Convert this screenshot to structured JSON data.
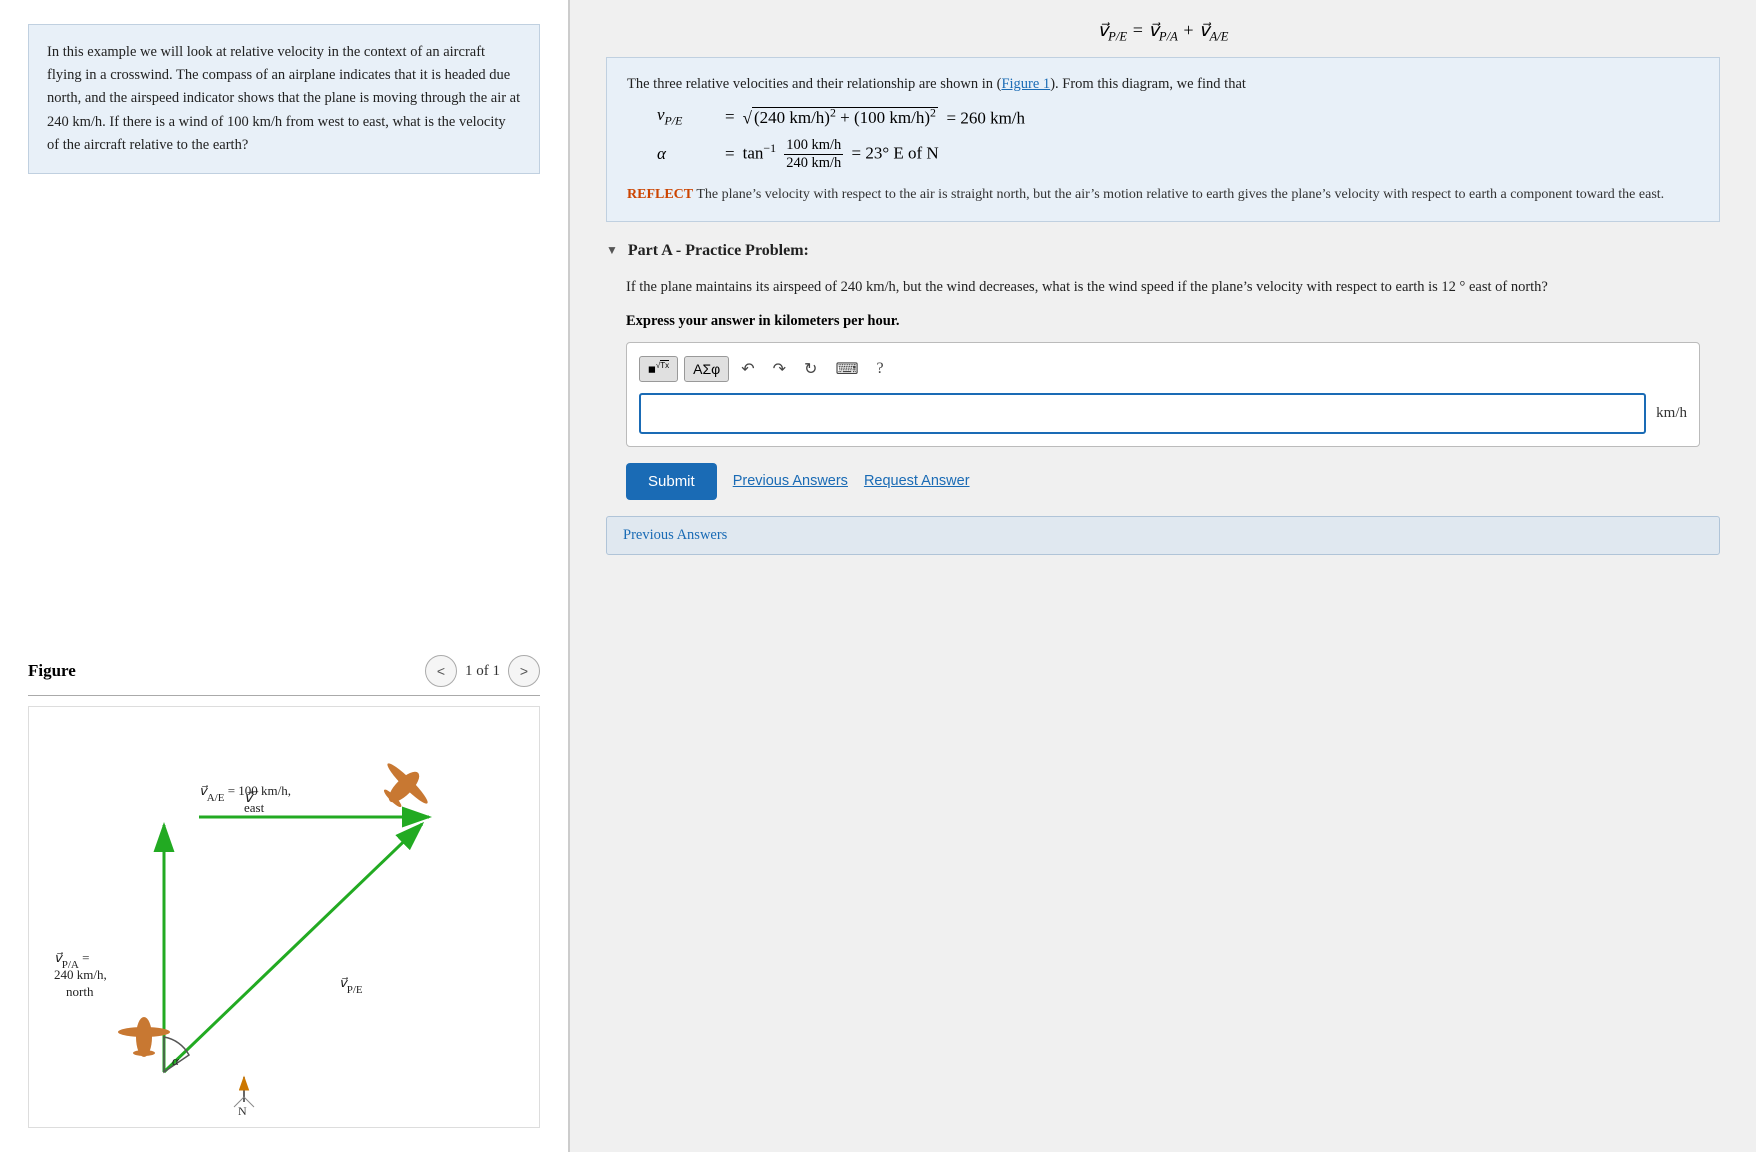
{
  "left": {
    "problem_text": "In this example we will look at relative velocity in the context of an aircraft flying in a crosswind. The compass of an airplane indicates that it is headed due north, and the airspeed indicator shows that the plane is moving through the air at 240 km/h. If there is a wind of 100 km/h from west to east, what is the velocity of the aircraft relative to the earth?",
    "figure_title": "Figure",
    "figure_count": "1 of 1",
    "nav_prev": "<",
    "nav_next": ">"
  },
  "right": {
    "formula_top": "v⃗_{P/E} = v⃗_{P/A} + v⃗_{A/E}",
    "solution_intro": "The three relative velocities and their relationship are shown in (Figure 1). From this diagram, we find that",
    "figure_ref": "Figure 1",
    "math_line1_label": "v_{P/E}",
    "math_line1_eq": "= √((240 km/h)² + (100 km/h)²) = 260 km/h",
    "math_line2_label": "α",
    "math_line2_eq": "= tan⁻¹ (100 km/h / 240 km/h) = 23° E of N",
    "reflect_label": "REFLECT",
    "reflect_text": "The plane’s velocity with respect to the air is straight north, but the air’s motion relative to earth gives the plane’s velocity with respect to earth a component toward the east.",
    "part_a_label": "Part A - Practice Problem:",
    "practice_text": "If the plane maintains its airspeed of 240 km/h, but the wind decreases, what is the wind speed if the plane’s velocity with respect to earth is 12 ° east of north?",
    "express_label": "Express your answer in kilometers per hour.",
    "toolbar": {
      "matrix_btn": "■√Tx",
      "symbol_btn": "AΣφ",
      "undo_icon": "↰",
      "redo_icon": "↱",
      "refresh_icon": "↻",
      "keyboard_icon": "⌨",
      "help_icon": "?"
    },
    "input_placeholder": "",
    "unit_label": "km/h",
    "submit_label": "Submit",
    "previous_answers_label": "Previous Answers",
    "request_answer_label": "Request Answer"
  }
}
